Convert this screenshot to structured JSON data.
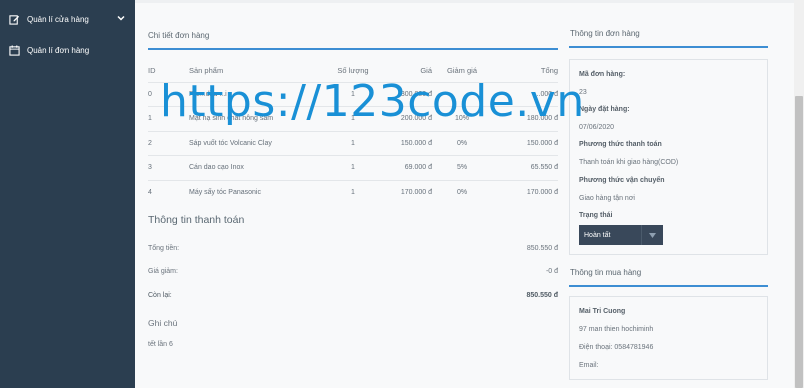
{
  "sidebar": {
    "items": [
      {
        "label": "Quản lí cửa hàng",
        "icon": "edit-icon"
      },
      {
        "label": "Quản lí đơn hàng",
        "icon": "calendar-icon"
      }
    ]
  },
  "order_detail": {
    "title": "Chi tiết đơn hàng",
    "columns": [
      "ID",
      "Sản phẩm",
      "Số lượng",
      "Giá",
      "Giảm giá",
      "Tổng"
    ],
    "rows": [
      {
        "id": "0",
        "name": "Pre...dầu ...i",
        "qty": "1",
        "price": "300.000 đ",
        "discount": "",
        "total": "...000 đ"
      },
      {
        "id": "1",
        "name": "Mặt nạ sinh chất nông sâm",
        "qty": "1",
        "price": "200.000 đ",
        "discount": "10%",
        "total": "180.000 đ"
      },
      {
        "id": "2",
        "name": "Sáp vuốt tóc Volcanic Clay",
        "qty": "1",
        "price": "150.000 đ",
        "discount": "0%",
        "total": "150.000 đ"
      },
      {
        "id": "3",
        "name": "Cán dao cạo Inox",
        "qty": "1",
        "price": "69.000 đ",
        "discount": "5%",
        "total": "65.550 đ"
      },
      {
        "id": "4",
        "name": "Máy sấy tóc Panasonic",
        "qty": "1",
        "price": "170.000 đ",
        "discount": "0%",
        "total": "170.000 đ"
      }
    ]
  },
  "payment": {
    "title": "Thông tin thanh toán",
    "subtotal_label": "Tổng tiền:",
    "subtotal_value": "850.550 đ",
    "discount_label": "Giá giảm:",
    "discount_value": "-0 đ",
    "remaining_label": "Còn lại:",
    "remaining_value": "850.550 đ",
    "note_title": "Ghi chú",
    "note_text": "tết lần 6"
  },
  "order_info": {
    "title": "Thông tin đơn hàng",
    "order_id_label": "Mã đơn hàng:",
    "order_id": "23",
    "date_label": "Ngày đặt hàng:",
    "date": "07/06/2020",
    "payment_method_label": "Phương thức thanh toán",
    "payment_method": "Thanh toán khi giao hàng(COD)",
    "shipping_method_label": "Phương thức vận chuyển",
    "shipping_method": "Giao hàng tận nơi",
    "status_label": "Trạng thái",
    "status_value": "Hoàn tất"
  },
  "buyer_info": {
    "title": "Thông tin mua hàng",
    "name": "Mai Tri Cuong",
    "address": "97 man thien hochiminh",
    "phone": "Điện thoại: 0584781946",
    "email": "Email:"
  },
  "watermark": "https://123code.vn",
  "colors": {
    "sidebar": "#2b3e50",
    "accent": "#3d8ed3",
    "watermark": "#1990d6",
    "select": "#39485a"
  }
}
